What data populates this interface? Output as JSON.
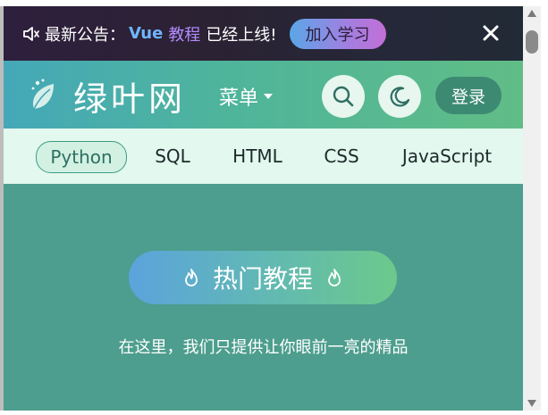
{
  "announcement": {
    "prefix": "最新公告：",
    "highlight_vue": "Vue",
    "highlight_tutorial": "教程",
    "suffix": "已经上线!",
    "join_button": "加入学习",
    "icon": "speaker-muted-icon",
    "close_icon": "close-icon"
  },
  "header": {
    "brand": "绿叶网",
    "menu_label": "菜单",
    "search_icon": "search-icon",
    "theme_icon": "moon-icon",
    "login_label": "登录"
  },
  "tabs": [
    "Python",
    "SQL",
    "HTML",
    "CSS",
    "JavaScript"
  ],
  "active_tab": "Python",
  "main": {
    "hot_button": "热门教程",
    "tagline": "在这里，我们只提供让你眼前一亮的精品"
  },
  "colors": {
    "accent_green": "#3d8a72",
    "page_bg": "#4d9e8e",
    "tab_bg": "#e3f8ee"
  }
}
